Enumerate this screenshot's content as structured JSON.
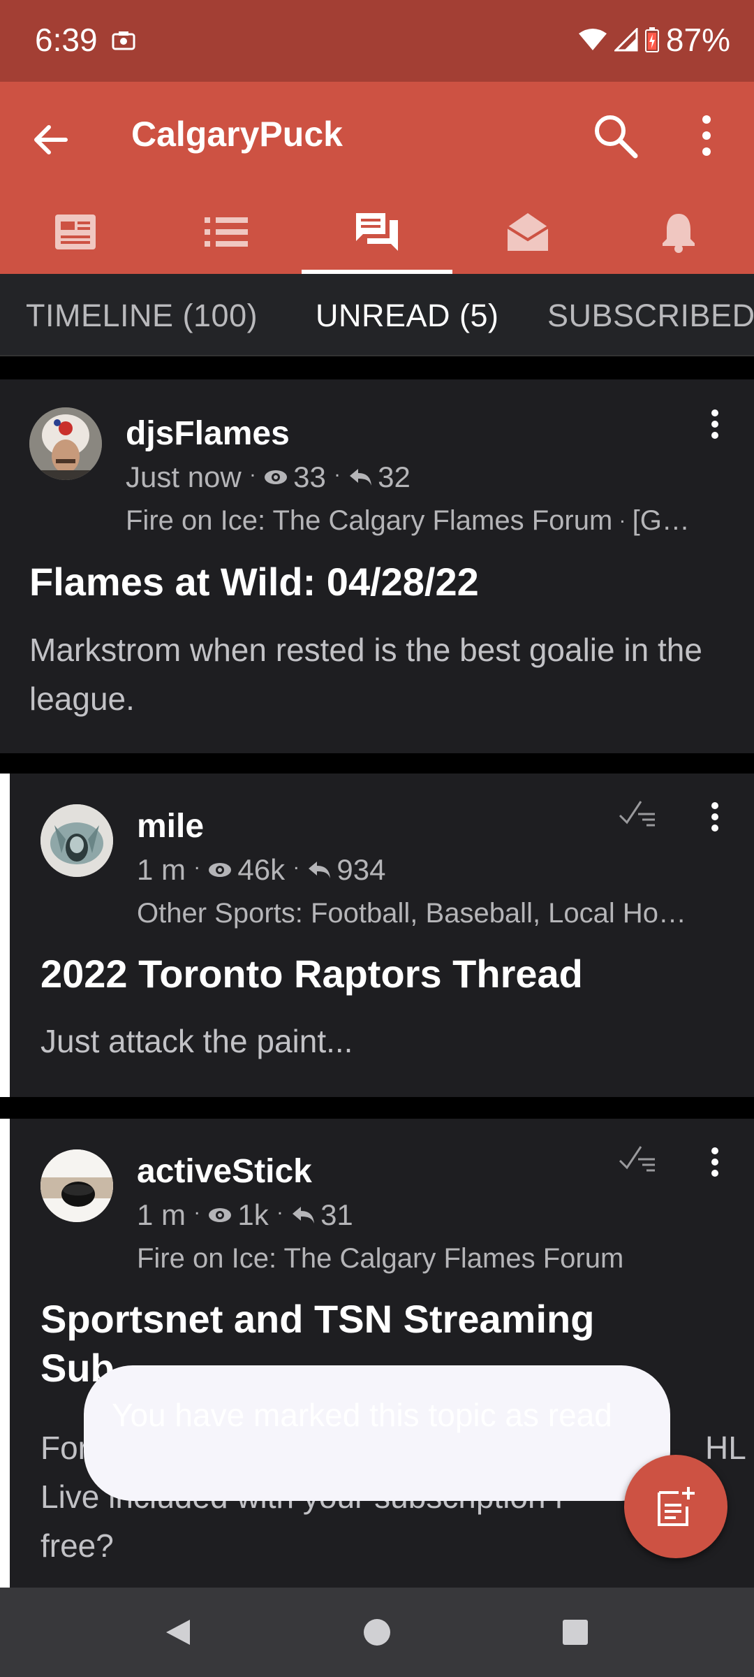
{
  "status_bar": {
    "time": "6:39",
    "battery": "87%"
  },
  "app_bar": {
    "title": "CalgaryPuck"
  },
  "icon_tabs": [
    {
      "icon": "news-icon"
    },
    {
      "icon": "list-icon"
    },
    {
      "icon": "forum-icon",
      "active": true
    },
    {
      "icon": "inbox-icon"
    },
    {
      "icon": "bell-icon"
    }
  ],
  "tabs": [
    {
      "label": "TIMELINE (100)"
    },
    {
      "label": "UNREAD (5)",
      "active": true
    },
    {
      "label": "SUBSCRIBED"
    }
  ],
  "posts": [
    {
      "author": "djsFlames",
      "time": "Just now",
      "views": "33",
      "replies": "32",
      "category": "Fire on Ice: The Calgary Flames Forum",
      "category_extra": "[G…",
      "title": "Flames at Wild: 04/28/22",
      "excerpt": "Markstrom when rested is the best goalie in the league."
    },
    {
      "author": "mile",
      "time": "1 m",
      "views": "46k",
      "replies": "934",
      "category": "Other Sports: Football, Baseball, Local Ho…",
      "title": "2022 Toronto Raptors Thread",
      "excerpt": "Just attack the paint..."
    },
    {
      "author": "activeStick",
      "time": "1 m",
      "views": "1k",
      "replies": "31",
      "category": "Fire on Ice: The Calgary Flames Forum",
      "title_visible_line1": "Sportsnet and TSN Streaming",
      "title_visible_line2": "Sub",
      "excerpt_line1_start": "For",
      "excerpt_line1_end": "HL",
      "excerpt_line2": "Live included with your subscription f",
      "excerpt_line3": "free?"
    }
  ],
  "snackbar": {
    "message": "You have marked this topic as read"
  },
  "colors": {
    "status_bar": "#a33f34",
    "app_bar": "#cd5243",
    "tab_bar": "#232427",
    "card": "#1e1e21",
    "fab": "#cd5243"
  }
}
